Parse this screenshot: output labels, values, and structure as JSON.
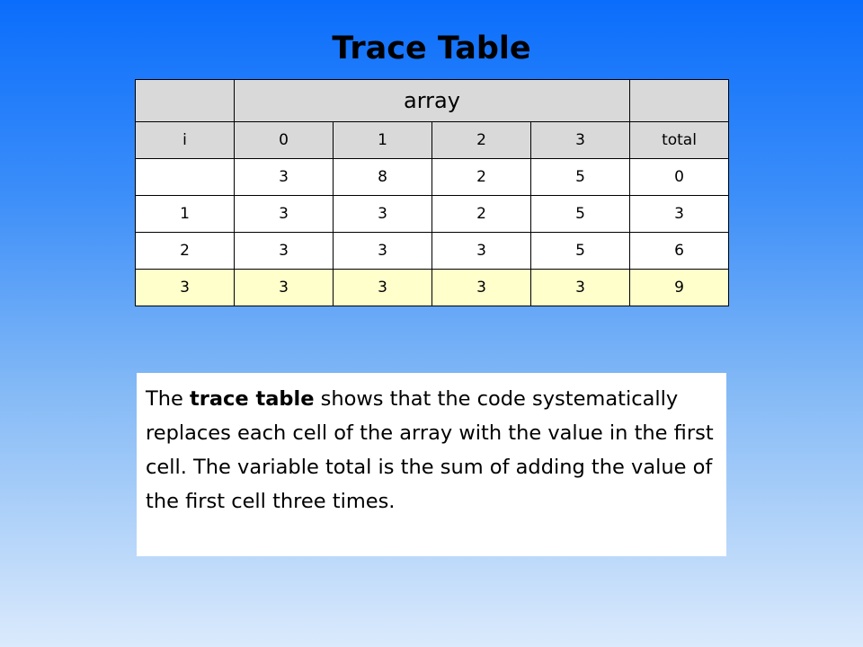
{
  "title": "Trace Table",
  "table": {
    "array_header": "array",
    "index_headers": [
      "i",
      "0",
      "1",
      "2",
      "3",
      "total"
    ],
    "rows": [
      [
        "",
        "3",
        "8",
        "2",
        "5",
        "0"
      ],
      [
        "1",
        "3",
        "3",
        "2",
        "5",
        "3"
      ],
      [
        "2",
        "3",
        "3",
        "3",
        "5",
        "6"
      ],
      [
        "3",
        "3",
        "3",
        "3",
        "3",
        "9"
      ]
    ],
    "highlight_color": "#ffffcc",
    "header_color": "#d9d9d9"
  },
  "note": {
    "part1": "The ",
    "bold": "trace table",
    "part2": " shows that the code systematically replaces each cell of the array with the value in the first cell. The variable total is the sum of adding the value of the first cell three times."
  }
}
